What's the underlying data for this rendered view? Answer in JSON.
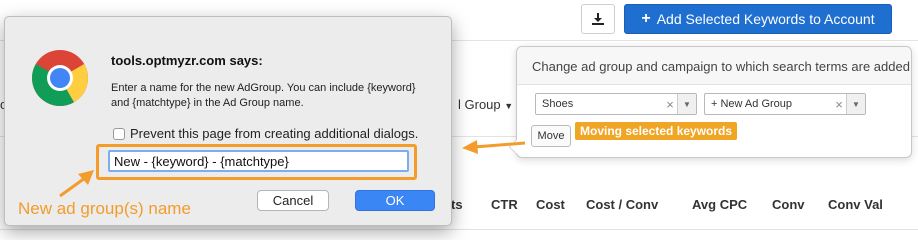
{
  "header": {
    "download_icon": "download-icon",
    "add_button_label": "Add Selected Keywords to Account",
    "add_button_icon": "plus-icon"
  },
  "background": {
    "left_fragment": "o",
    "adgroup_label": "l Group",
    "table_headers": [
      "ts",
      "CTR",
      "Cost",
      "Cost / Conv",
      "Avg CPC",
      "Conv",
      "Conv Val"
    ]
  },
  "popover": {
    "header_text": "Change ad group and campaign to which search terms are added",
    "campaign_select": {
      "value": "Shoes",
      "clear": "×"
    },
    "adgroup_select": {
      "value": "+ New Ad Group",
      "clear": "×"
    },
    "move_button": "Move",
    "moving_label": "Moving selected keywords"
  },
  "dialog": {
    "title": "tools.optmyzr.com says:",
    "message": "Enter a name for the new AdGroup. You can include {keyword} and {matchtype} in the Ad Group name.",
    "checkbox_label": "Prevent this page from creating additional dialogs.",
    "input_value": "New - {keyword} - {matchtype}",
    "cancel_label": "Cancel",
    "ok_label": "OK",
    "logo_icon": "chrome-logo-icon"
  },
  "annotation": {
    "label": "New ad group(s) name"
  },
  "colors": {
    "primary": "#1e6fd0",
    "annotation_orange": "#f39c2b",
    "moving_badge": "#f0a524",
    "ok_button": "#3b86f5"
  }
}
